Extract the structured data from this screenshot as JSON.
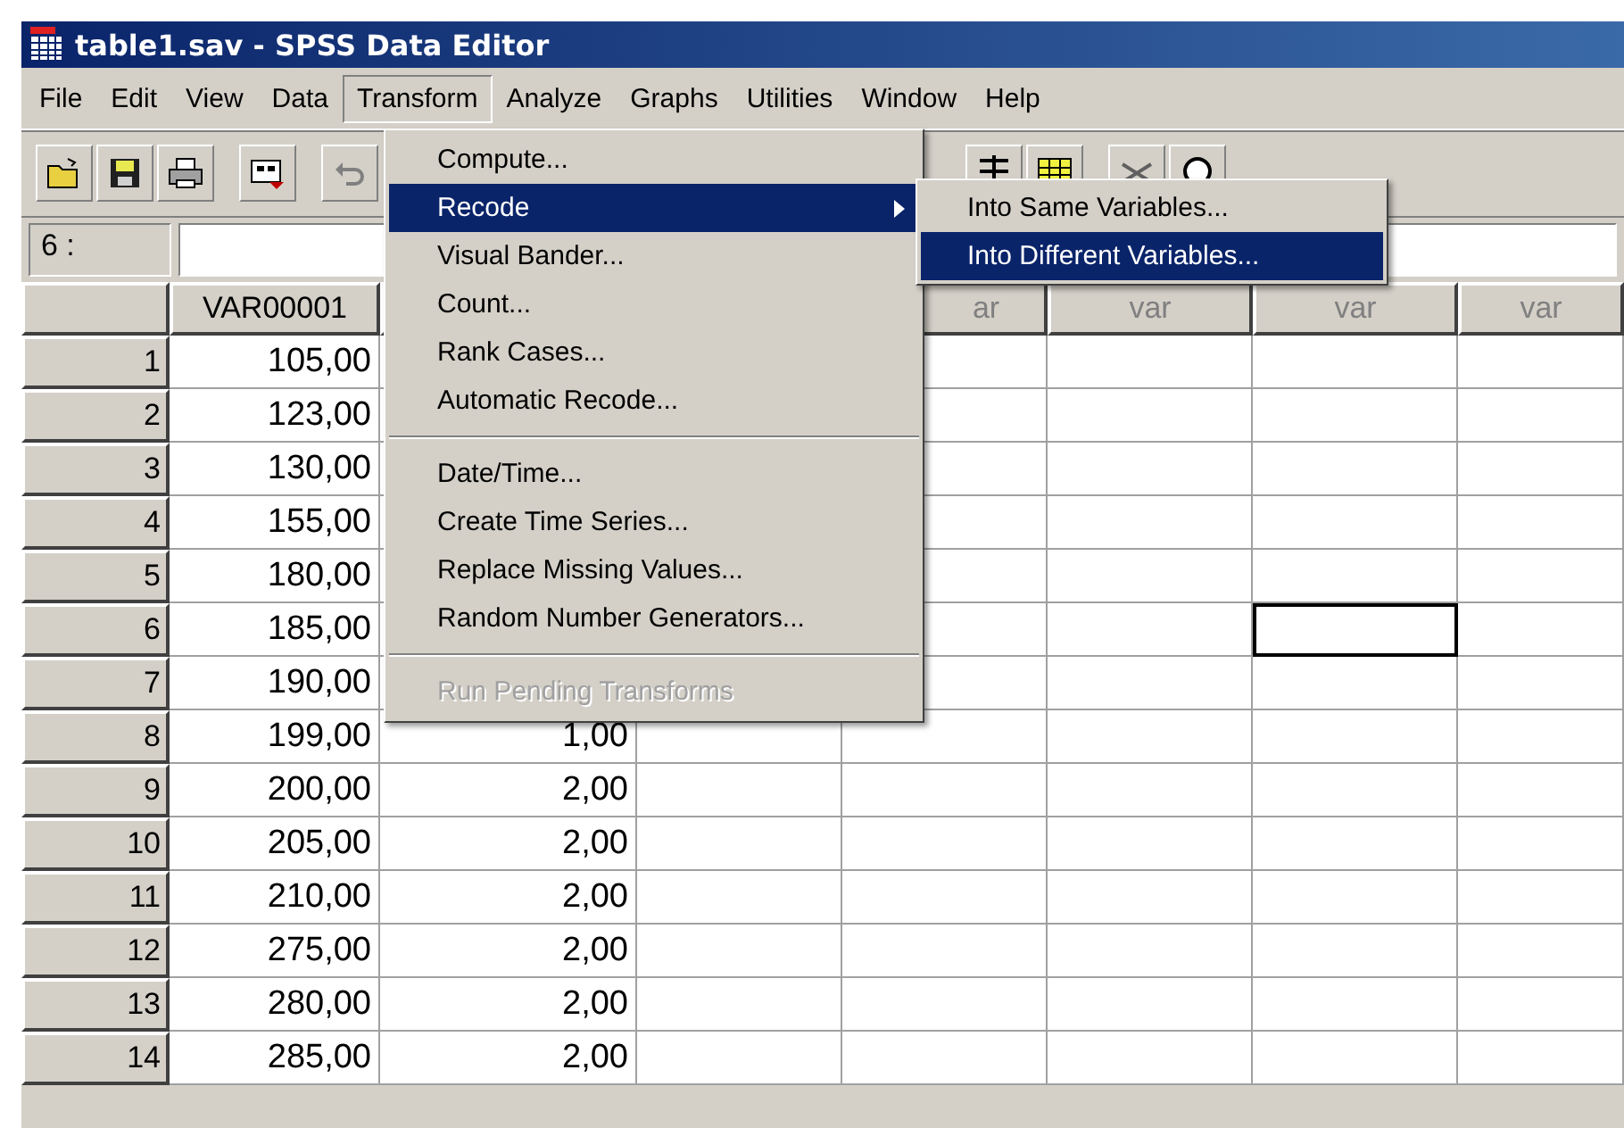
{
  "window": {
    "title": "table1.sav - SPSS Data Editor"
  },
  "menubar": [
    {
      "label": "File",
      "selected": false
    },
    {
      "label": "Edit",
      "selected": false
    },
    {
      "label": "View",
      "selected": false
    },
    {
      "label": "Data",
      "selected": false
    },
    {
      "label": "Transform",
      "selected": true
    },
    {
      "label": "Analyze",
      "selected": false
    },
    {
      "label": "Graphs",
      "selected": false
    },
    {
      "label": "Utilities",
      "selected": false
    },
    {
      "label": "Window",
      "selected": false
    },
    {
      "label": "Help",
      "selected": false
    }
  ],
  "cell_editor": {
    "label": "6 :"
  },
  "grid": {
    "headings": [
      {
        "kind": "label",
        "text": "VAR00001"
      },
      {
        "kind": "covered"
      },
      {
        "kind": "covered"
      },
      {
        "kind": "label",
        "text": "ar"
      },
      {
        "kind": "label",
        "text": "var"
      },
      {
        "kind": "label",
        "text": "var"
      },
      {
        "kind": "label",
        "text": "var"
      }
    ],
    "rows": [
      {
        "number": "1",
        "cells": [
          {
            "kind": "value",
            "text": "105,00",
            "selected": false
          },
          {
            "kind": "covered"
          },
          {
            "kind": "covered"
          },
          {
            "kind": "value",
            "selected": false
          },
          {
            "kind": "value",
            "selected": false
          },
          {
            "kind": "value",
            "selected": false
          },
          {
            "kind": "value",
            "selected": false
          }
        ]
      },
      {
        "number": "2",
        "cells": [
          {
            "kind": "value",
            "text": "123,00",
            "selected": false
          },
          {
            "kind": "covered"
          },
          {
            "kind": "covered"
          },
          {
            "kind": "value",
            "selected": false
          },
          {
            "kind": "value",
            "selected": false
          },
          {
            "kind": "value",
            "selected": false
          },
          {
            "kind": "value",
            "selected": false
          }
        ]
      },
      {
        "number": "3",
        "cells": [
          {
            "kind": "value",
            "text": "130,00",
            "selected": false
          },
          {
            "kind": "covered"
          },
          {
            "kind": "covered"
          },
          {
            "kind": "value",
            "selected": false
          },
          {
            "kind": "value",
            "selected": false
          },
          {
            "kind": "value",
            "selected": false
          },
          {
            "kind": "value",
            "selected": false
          }
        ]
      },
      {
        "number": "4",
        "cells": [
          {
            "kind": "value",
            "text": "155,00",
            "selected": false
          },
          {
            "kind": "covered"
          },
          {
            "kind": "covered"
          },
          {
            "kind": "value",
            "selected": false
          },
          {
            "kind": "value",
            "selected": false
          },
          {
            "kind": "value",
            "selected": false
          },
          {
            "kind": "value",
            "selected": false
          }
        ]
      },
      {
        "number": "5",
        "cells": [
          {
            "kind": "value",
            "text": "180,00",
            "selected": false
          },
          {
            "kind": "covered"
          },
          {
            "kind": "covered"
          },
          {
            "kind": "value",
            "selected": false
          },
          {
            "kind": "value",
            "selected": false
          },
          {
            "kind": "value",
            "selected": false
          },
          {
            "kind": "value",
            "selected": false
          }
        ]
      },
      {
        "number": "6",
        "cells": [
          {
            "kind": "value",
            "text": "185,00",
            "selected": false
          },
          {
            "kind": "covered"
          },
          {
            "kind": "covered"
          },
          {
            "kind": "value",
            "selected": false
          },
          {
            "kind": "value",
            "selected": false
          },
          {
            "kind": "value",
            "selected": true
          },
          {
            "kind": "value",
            "selected": false
          }
        ]
      },
      {
        "number": "7",
        "cells": [
          {
            "kind": "value",
            "text": "190,00",
            "selected": false
          },
          {
            "kind": "covered"
          },
          {
            "kind": "covered"
          },
          {
            "kind": "value",
            "selected": false
          },
          {
            "kind": "value",
            "selected": false
          },
          {
            "kind": "value",
            "selected": false
          },
          {
            "kind": "value",
            "selected": false
          }
        ]
      },
      {
        "number": "8",
        "cells": [
          {
            "kind": "value",
            "text": "199,00",
            "selected": false
          },
          {
            "kind": "value",
            "text": "1,00",
            "selected": false
          },
          {
            "kind": "value",
            "selected": false
          },
          {
            "kind": "value",
            "selected": false
          },
          {
            "kind": "value",
            "selected": false
          },
          {
            "kind": "value",
            "selected": false
          },
          {
            "kind": "value",
            "selected": false
          }
        ]
      },
      {
        "number": "9",
        "cells": [
          {
            "kind": "value",
            "text": "200,00",
            "selected": false
          },
          {
            "kind": "value",
            "text": "2,00",
            "selected": false
          },
          {
            "kind": "value",
            "selected": false
          },
          {
            "kind": "value",
            "selected": false
          },
          {
            "kind": "value",
            "selected": false
          },
          {
            "kind": "value",
            "selected": false
          },
          {
            "kind": "value",
            "selected": false
          }
        ]
      },
      {
        "number": "10",
        "cells": [
          {
            "kind": "value",
            "text": "205,00",
            "selected": false
          },
          {
            "kind": "value",
            "text": "2,00",
            "selected": false
          },
          {
            "kind": "value",
            "selected": false
          },
          {
            "kind": "value",
            "selected": false
          },
          {
            "kind": "value",
            "selected": false
          },
          {
            "kind": "value",
            "selected": false
          },
          {
            "kind": "value",
            "selected": false
          }
        ]
      },
      {
        "number": "11",
        "cells": [
          {
            "kind": "value",
            "text": "210,00",
            "selected": false
          },
          {
            "kind": "value",
            "text": "2,00",
            "selected": false
          },
          {
            "kind": "value",
            "selected": false
          },
          {
            "kind": "value",
            "selected": false
          },
          {
            "kind": "value",
            "selected": false
          },
          {
            "kind": "value",
            "selected": false
          },
          {
            "kind": "value",
            "selected": false
          }
        ]
      },
      {
        "number": "12",
        "cells": [
          {
            "kind": "value",
            "text": "275,00",
            "selected": false
          },
          {
            "kind": "value",
            "text": "2,00",
            "selected": false
          },
          {
            "kind": "value",
            "selected": false
          },
          {
            "kind": "value",
            "selected": false
          },
          {
            "kind": "value",
            "selected": false
          },
          {
            "kind": "value",
            "selected": false
          },
          {
            "kind": "value",
            "selected": false
          }
        ]
      },
      {
        "number": "13",
        "cells": [
          {
            "kind": "value",
            "text": "280,00",
            "selected": false
          },
          {
            "kind": "value",
            "text": "2,00",
            "selected": false
          },
          {
            "kind": "value",
            "selected": false
          },
          {
            "kind": "value",
            "selected": false
          },
          {
            "kind": "value",
            "selected": false
          },
          {
            "kind": "value",
            "selected": false
          },
          {
            "kind": "value",
            "selected": false
          }
        ]
      },
      {
        "number": "14",
        "cells": [
          {
            "kind": "value",
            "text": "285,00",
            "selected": false
          },
          {
            "kind": "value",
            "text": "2,00",
            "selected": false
          },
          {
            "kind": "value",
            "selected": false
          },
          {
            "kind": "value",
            "selected": false
          },
          {
            "kind": "value",
            "selected": false
          },
          {
            "kind": "value",
            "selected": false
          },
          {
            "kind": "value",
            "selected": false
          }
        ]
      }
    ]
  },
  "transform_menu": {
    "items": [
      {
        "kind": "item",
        "label": "Compute...",
        "selected": false,
        "disabled": false
      },
      {
        "kind": "item",
        "label": "Recode",
        "selected": true,
        "disabled": false,
        "submenu": true
      },
      {
        "kind": "item",
        "label": "Visual Bander...",
        "selected": false,
        "disabled": false
      },
      {
        "kind": "item",
        "label": "Count...",
        "selected": false,
        "disabled": false
      },
      {
        "kind": "item",
        "label": "Rank Cases...",
        "selected": false,
        "disabled": false
      },
      {
        "kind": "item",
        "label": "Automatic Recode...",
        "selected": false,
        "disabled": false
      },
      {
        "kind": "separator"
      },
      {
        "kind": "item",
        "label": "Date/Time...",
        "selected": false,
        "disabled": false
      },
      {
        "kind": "item",
        "label": "Create Time Series...",
        "selected": false,
        "disabled": false
      },
      {
        "kind": "item",
        "label": "Replace Missing Values...",
        "selected": false,
        "disabled": false
      },
      {
        "kind": "item",
        "label": "Random Number Generators...",
        "selected": false,
        "disabled": false
      },
      {
        "kind": "separator"
      },
      {
        "kind": "item",
        "label": "Run Pending Transforms",
        "selected": false,
        "disabled": true
      }
    ]
  },
  "recode_submenu": {
    "items": [
      {
        "label": "Into Same Variables...",
        "selected": false
      },
      {
        "label": "Into Different Variables...",
        "selected": true
      }
    ]
  }
}
